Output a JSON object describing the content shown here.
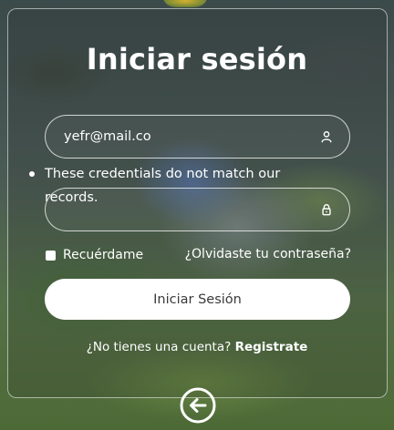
{
  "login": {
    "title": "Iniciar sesión",
    "email_value": "yefr@mail.co",
    "email_placeholder": "",
    "password_value": "",
    "password_placeholder": "",
    "error_message": "These credentials do not match our records.",
    "remember_label": "Recuérdame",
    "remember_checked": false,
    "forgot_label": "¿Olvidaste tu contraseña?",
    "submit_label": "Iniciar Sesión",
    "signup_prompt": "¿No tienes una cuenta?",
    "signup_link": "Registrate"
  },
  "icons": {
    "email_field": "user-icon",
    "password_field": "lock-icon",
    "back": "arrow-left-circle-icon"
  },
  "colors": {
    "text": "#ffffff",
    "button_bg": "#ffffff",
    "button_text": "#3a3a3a"
  }
}
